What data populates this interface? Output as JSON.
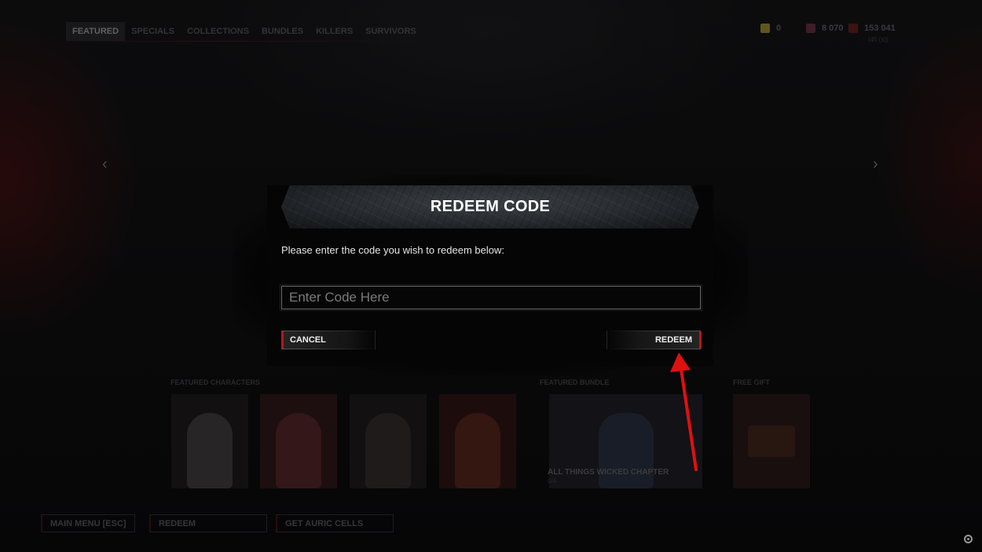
{
  "store": {
    "tabs": [
      {
        "label": "FEATURED",
        "active": true
      },
      {
        "label": "SPECIALS",
        "active": false
      },
      {
        "label": "COLLECTIONS",
        "active": false
      },
      {
        "label": "BUNDLES",
        "active": false
      },
      {
        "label": "KILLERS",
        "active": false
      },
      {
        "label": "SURVIVORS",
        "active": false
      }
    ],
    "currencies": [
      {
        "icon": "auric-cells-icon",
        "value": "0",
        "color": "#8a7a2a"
      },
      {
        "icon": "iridescent-shards-icon",
        "value": "8 070",
        "color": "#5a2a3a"
      },
      {
        "icon": "bloodpoints-icon",
        "value": "153 041",
        "color": "#5a1a1a"
      }
    ],
    "currency_sub": "(45 (s))",
    "sections": {
      "featured_characters": "FEATURED CHARACTERS",
      "featured_bundle": "FEATURED BUNDLE",
      "free_gift": "FREE GIFT"
    },
    "bundle": {
      "name": "ALL THINGS WICKED CHAPTER",
      "progress": "0/4"
    },
    "bottom_buttons": {
      "main_menu": "MAIN MENU",
      "main_menu_key": "[ESC]",
      "redeem": "REDEEM",
      "get_auric_cells": "GET AURIC CELLS"
    }
  },
  "modal": {
    "title": "REDEEM CODE",
    "prompt": "Please enter the code you wish to redeem below:",
    "input_value": "",
    "input_placeholder": "Enter Code Here",
    "cancel_label": "CANCEL",
    "redeem_label": "REDEEM"
  },
  "colors": {
    "accent_red": "#b01a1a",
    "arrow_red": "#e01010"
  }
}
